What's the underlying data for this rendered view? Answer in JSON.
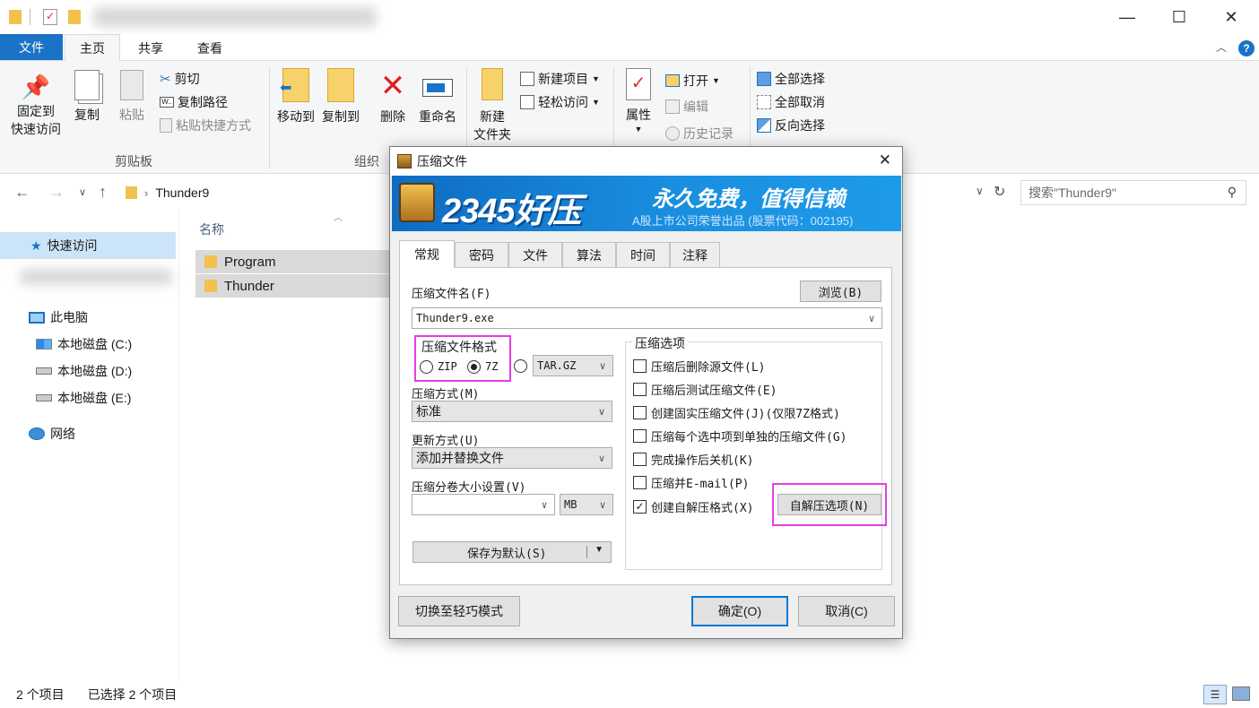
{
  "window": {
    "min_glyph": "—",
    "max_glyph": "☐",
    "close_glyph": "✕"
  },
  "ribbon_tabs": {
    "file": "文件",
    "home": "主页",
    "share": "共享",
    "view": "查看"
  },
  "ribbon": {
    "clipboard": {
      "pin_line1": "固定到",
      "pin_line2": "快速访问",
      "copy": "复制",
      "paste": "粘贴",
      "cut": "剪切",
      "copy_path": "复制路径",
      "paste_shortcut": "粘贴快捷方式",
      "label": "剪贴板"
    },
    "organize": {
      "move_to": "移动到",
      "copy_to": "复制到",
      "delete": "删除",
      "rename": "重命名",
      "label": "组织"
    },
    "new": {
      "new_folder_line1": "新建",
      "new_folder_line2": "文件夹",
      "new_item": "新建项目",
      "easy_access": "轻松访问"
    },
    "open": {
      "properties": "属性",
      "open": "打开",
      "edit": "编辑",
      "history": "历史记录"
    },
    "select": {
      "select_all": "全部选择",
      "select_none": "全部取消",
      "invert": "反向选择"
    }
  },
  "address": {
    "path": "Thunder9",
    "search_placeholder": "搜索\"Thunder9\""
  },
  "sidebar": {
    "quick_access": "快速访问",
    "this_pc": "此电脑",
    "drives": [
      "本地磁盘 (C:)",
      "本地磁盘 (D:)",
      "本地磁盘 (E:)"
    ],
    "network": "网络"
  },
  "files": {
    "column_name": "名称",
    "items": [
      "Program",
      "Thunder"
    ]
  },
  "status": {
    "count": "2 个项目",
    "selected": "已选择 2 个项目"
  },
  "dialog": {
    "title": "压缩文件",
    "banner_brand": "2345好压",
    "banner_slogan": "永久免费，值得信赖",
    "banner_sub": "A股上市公司荣誉出品 (股票代码：002195)",
    "tabs": [
      "常规",
      "密码",
      "文件",
      "算法",
      "时间",
      "注释"
    ],
    "archive_name_label": "压缩文件名(F)",
    "browse": "浏览(B)",
    "archive_name_value": "Thunder9.exe",
    "format_label": "压缩文件格式",
    "format_zip": "ZIP",
    "format_7z": "7Z",
    "format_targz": "TAR.GZ",
    "method_label": "压缩方式(M)",
    "method_value": "标准",
    "update_label": "更新方式(U)",
    "update_value": "添加并替换文件",
    "split_label": "压缩分卷大小设置(V)",
    "split_value": "",
    "split_unit": "MB",
    "save_default": "保存为默认(S)",
    "options_label": "压缩选项",
    "options": [
      {
        "label": "压缩后删除源文件(L)",
        "checked": false
      },
      {
        "label": "压缩后测试压缩文件(E)",
        "checked": false
      },
      {
        "label": "创建固实压缩文件(J)(仅限7Z格式)",
        "checked": false
      },
      {
        "label": "压缩每个选中项到单独的压缩文件(G)",
        "checked": false
      },
      {
        "label": "完成操作后关机(K)",
        "checked": false
      },
      {
        "label": "压缩并E-mail(P)",
        "checked": false
      },
      {
        "label": "创建自解压格式(X)",
        "checked": true
      }
    ],
    "sfx_options": "自解压选项(N)",
    "switch_mode": "切换至轻巧模式",
    "ok": "确定(O)",
    "cancel": "取消(C)",
    "close_glyph": "✕"
  }
}
